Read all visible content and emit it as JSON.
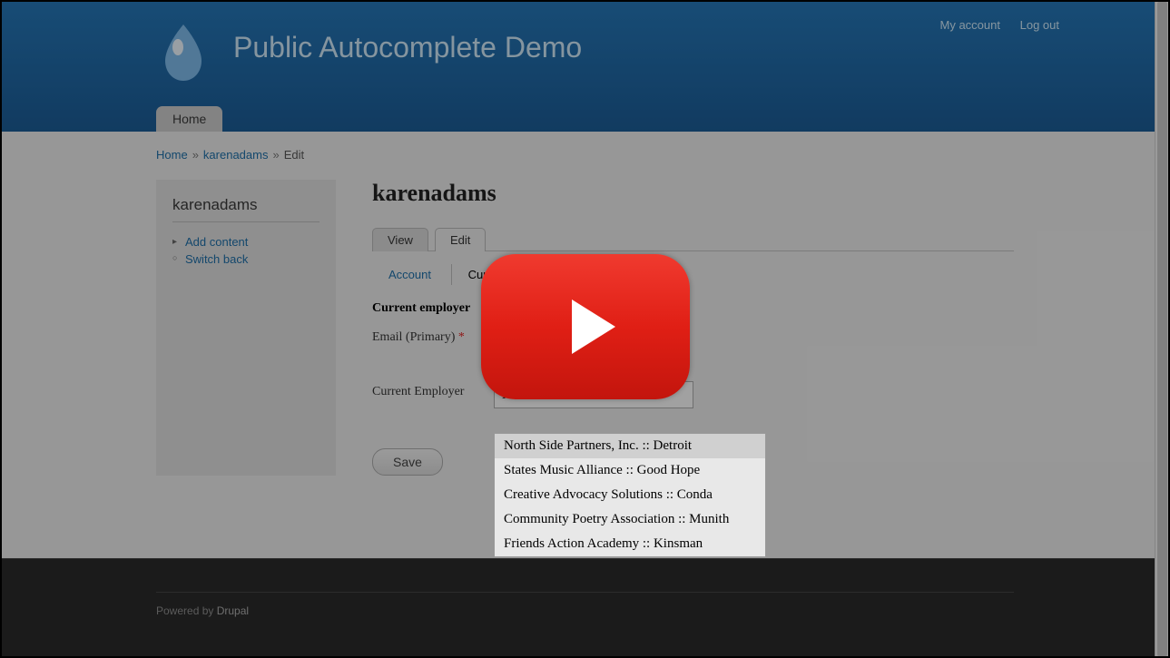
{
  "header": {
    "site_title": "Public Autocomplete Demo",
    "user_links": {
      "account": "My account",
      "logout": "Log out"
    },
    "nav": {
      "home": "Home"
    }
  },
  "breadcrumb": {
    "home": "Home",
    "user": "karenadams",
    "edit": "Edit"
  },
  "sidebar": {
    "title": "karenadams",
    "add_content": "Add content",
    "switch_back": "Switch back"
  },
  "main": {
    "title": "karenadams",
    "tabs": {
      "view": "View",
      "edit": "Edit"
    },
    "subtabs": {
      "account": "Account",
      "current": "Curr"
    },
    "section_heading": "Current employer",
    "email_label": "Email (Primary)",
    "employer_label": "Current Employer",
    "employer_value": "N",
    "save": "Save"
  },
  "autocomplete": {
    "options": [
      "North Side Partners, Inc. :: Detroit",
      "States Music Alliance :: Good Hope",
      "Creative Advocacy Solutions :: Conda",
      "Community Poetry Association :: Munith",
      "Friends Action Academy :: Kinsman"
    ]
  },
  "footer": {
    "powered": "Powered by ",
    "drupal": "Drupal"
  }
}
